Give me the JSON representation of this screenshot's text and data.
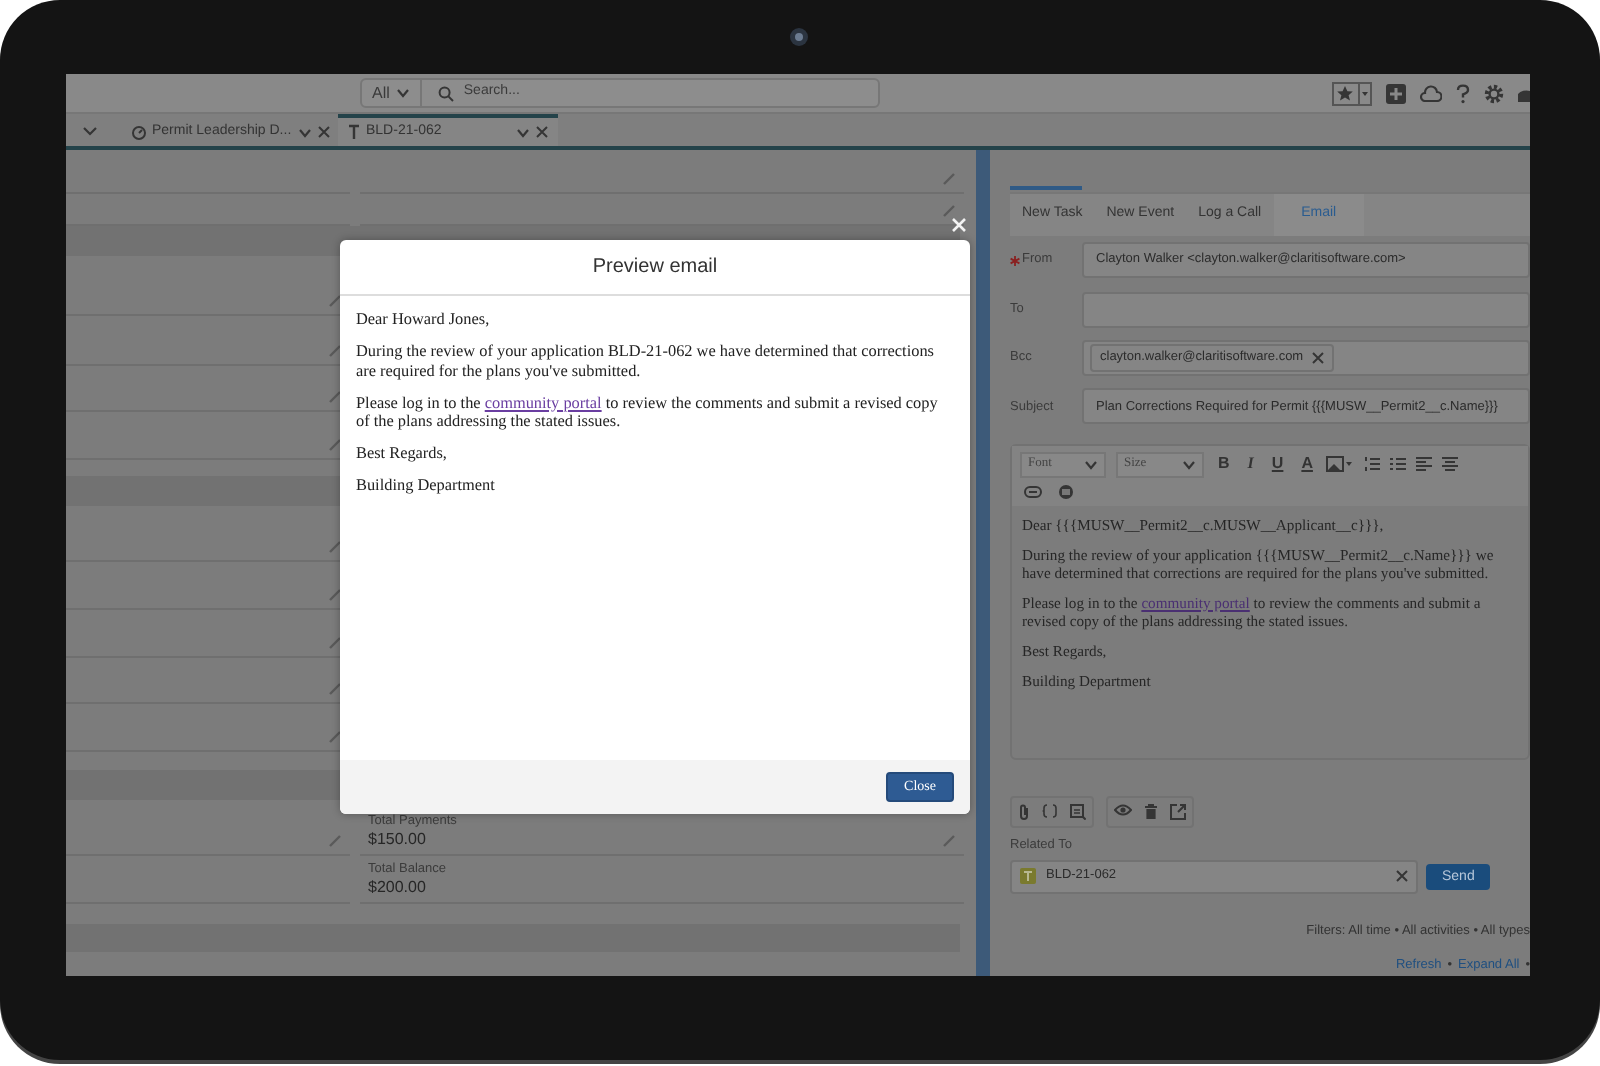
{
  "header": {
    "search_scope": "All",
    "search_placeholder": "Search..."
  },
  "tabs": [
    {
      "label": "Permit Leadership D...",
      "selected": false,
      "kind": "dashboard"
    },
    {
      "label": "BLD-21-062",
      "selected": true,
      "kind": "permit"
    }
  ],
  "record_fields": [
    {
      "label": "Total Payments",
      "value": "$150.00"
    },
    {
      "label": "Total Balance",
      "value": "$200.00"
    }
  ],
  "activity": {
    "tabs": [
      {
        "label": "New Task",
        "selected": false
      },
      {
        "label": "New Event",
        "selected": false
      },
      {
        "label": "Log a Call",
        "selected": false
      },
      {
        "label": "Email",
        "selected": true
      }
    ],
    "fields": [
      {
        "kind": "text",
        "label": "From",
        "required": true,
        "value": "Clayton Walker <clayton.walker@claritisoftware.com>"
      },
      {
        "kind": "text",
        "label": "To",
        "required": false
      },
      {
        "kind": "pills",
        "label": "Bcc",
        "required": false,
        "pills": [
          "clayton.walker@claritisoftware.com"
        ]
      },
      {
        "kind": "text",
        "label": "Subject",
        "required": false,
        "value": "Plan Corrections Required for Permit {{{MUSW__Permit2__c.Name}}}"
      }
    ],
    "editor": {
      "font_placeholder": "Font",
      "size_placeholder": "Size",
      "format_buttons": [
        "B",
        "I",
        "U"
      ],
      "color_button": "A",
      "body": [
        {
          "text": "Dear {{{MUSW__Permit2__c.MUSW__Applicant__c}}},"
        },
        {
          "text": "During the review of your application {{{MUSW__Permit2__c.Name}}} we have determined that corrections are required for the plans you've submitted."
        },
        {
          "before": "Please log in to the ",
          "link": "community portal",
          "after": " to review the comments and submit a revised copy of the plans addressing the stated issues."
        },
        {
          "text": "Best Regards,"
        },
        {
          "text": "Building Department"
        }
      ]
    },
    "related_to": {
      "label": "Related To",
      "value": "BLD-21-062"
    },
    "send": "Send",
    "filters": "Filters: All time • All activities • All types",
    "links": [
      "Refresh",
      "Expand All"
    ],
    "separator": "•"
  },
  "modal": {
    "title": "Preview email",
    "body": [
      {
        "text": "Dear Howard Jones,"
      },
      {
        "text": "During the review of your application BLD-21-062 we have determined that corrections are required for the plans you've submitted."
      },
      {
        "before": "Please log in to the ",
        "link": "community portal",
        "after": " to review the comments and submit a revised copy of the plans addressing the stated issues."
      },
      {
        "text": "Best Regards,"
      },
      {
        "text": "Building Department"
      }
    ],
    "close": "Close"
  }
}
